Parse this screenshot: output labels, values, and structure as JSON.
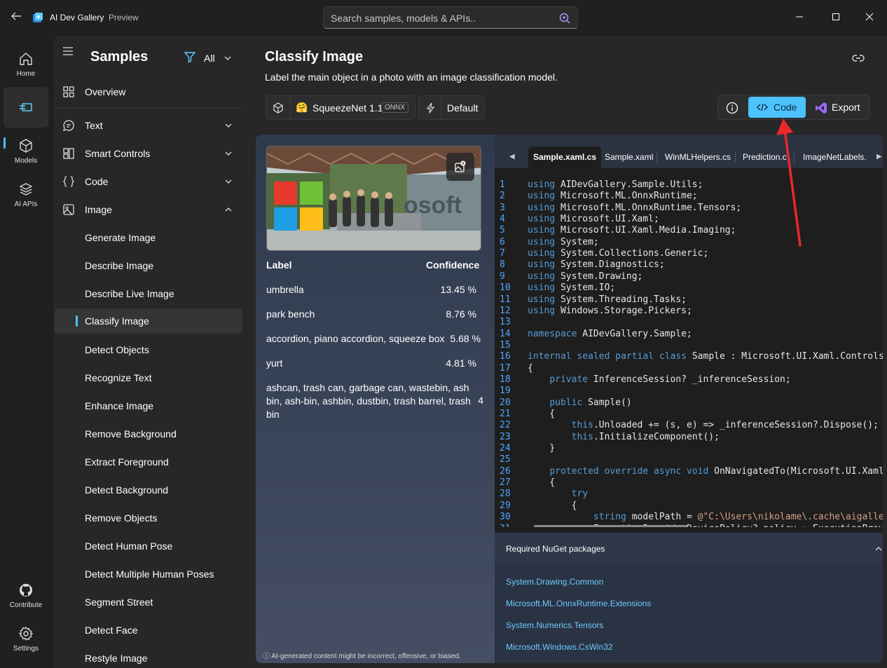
{
  "app": {
    "title": "AI Dev Gallery",
    "preview": "Preview"
  },
  "search": {
    "placeholder": "Search samples, models & APIs.."
  },
  "rail": [
    {
      "label": "Home"
    },
    {
      "label": ""
    },
    {
      "label": "Models"
    },
    {
      "label": "AI APIs"
    },
    {
      "label": "Contribute"
    },
    {
      "label": "Settings"
    }
  ],
  "samples": {
    "title": "Samples",
    "filter": "All",
    "overview": "Overview",
    "categories": [
      {
        "label": "Text"
      },
      {
        "label": "Smart Controls"
      },
      {
        "label": "Code"
      },
      {
        "label": "Image"
      }
    ],
    "image_items": [
      "Generate Image",
      "Describe Image",
      "Describe Live Image",
      "Classify Image",
      "Detect Objects",
      "Recognize Text",
      "Enhance Image",
      "Remove Background",
      "Extract Foreground",
      "Detect Background",
      "Remove Objects",
      "Detect Human Pose",
      "Detect Multiple Human Poses",
      "Segment Street",
      "Detect Face",
      "Restyle Image"
    ]
  },
  "page": {
    "title": "Classify Image",
    "description": "Label the main object in a photo with an image classification model.",
    "model_name": "SqueezeNet 1.1",
    "model_badge": "ONNX",
    "execution": "Default",
    "code_label": "Code",
    "export_label": "Export"
  },
  "results": {
    "label_header": "Label",
    "confidence_header": "Confidence",
    "rows": [
      {
        "label": "umbrella",
        "confidence": "13.45 %"
      },
      {
        "label": "park bench",
        "confidence": "8.76 %"
      },
      {
        "label": "accordion, piano accordion, squeeze box",
        "confidence": "5.68 %"
      },
      {
        "label": "yurt",
        "confidence": "4.81 %"
      },
      {
        "label": "ashcan, trash can, garbage can, wastebin, ash bin, ash-bin, ashbin, dustbin, trash barrel, trash bin",
        "confidence": "4"
      }
    ],
    "disclaimer": "ⓘ AI-generated content might be incorrect, offensive, or biased."
  },
  "code_tabs": [
    "Sample.xaml.cs",
    "Sample.xaml",
    "WinMLHelpers.cs",
    "Prediction.c",
    "ImageNetLabels."
  ],
  "code": [
    "using AIDevGallery.Sample.Utils;",
    "using Microsoft.ML.OnnxRuntime;",
    "using Microsoft.ML.OnnxRuntime.Tensors;",
    "using Microsoft.UI.Xaml;",
    "using Microsoft.UI.Xaml.Media.Imaging;",
    "using System;",
    "using System.Collections.Generic;",
    "using System.Diagnostics;",
    "using System.Drawing;",
    "using System.IO;",
    "using System.Threading.Tasks;",
    "using Windows.Storage.Pickers;",
    "",
    "namespace AIDevGallery.Sample;",
    "",
    "internal sealed partial class Sample : Microsoft.UI.Xaml.Controls.",
    "{",
    "    private InferenceSession? _inferenceSession;",
    "",
    "    public Sample()",
    "    {",
    "        this.Unloaded += (s, e) => _inferenceSession?.Dispose();",
    "        this.InitializeComponent();",
    "    }",
    "",
    "    protected override async void OnNavigatedTo(Microsoft.UI.Xaml.",
    "    {",
    "        try",
    "        {",
    "            string modelPath = @\"C:\\Users\\nikolame\\.cache\\aigaller",
    "            ExecutionProviderDevicePolicy? policy = ExecutionProvi"
  ],
  "nuget": {
    "title": "Required NuGet packages",
    "packages": [
      "System.Drawing.Common",
      "Microsoft.ML.OnnxRuntime.Extensions",
      "System.Numerics.Tensors",
      "Microsoft.Windows.CsWin32"
    ]
  },
  "colors": {
    "accent": "#4cc2ff",
    "annotation": "#e8282b"
  }
}
